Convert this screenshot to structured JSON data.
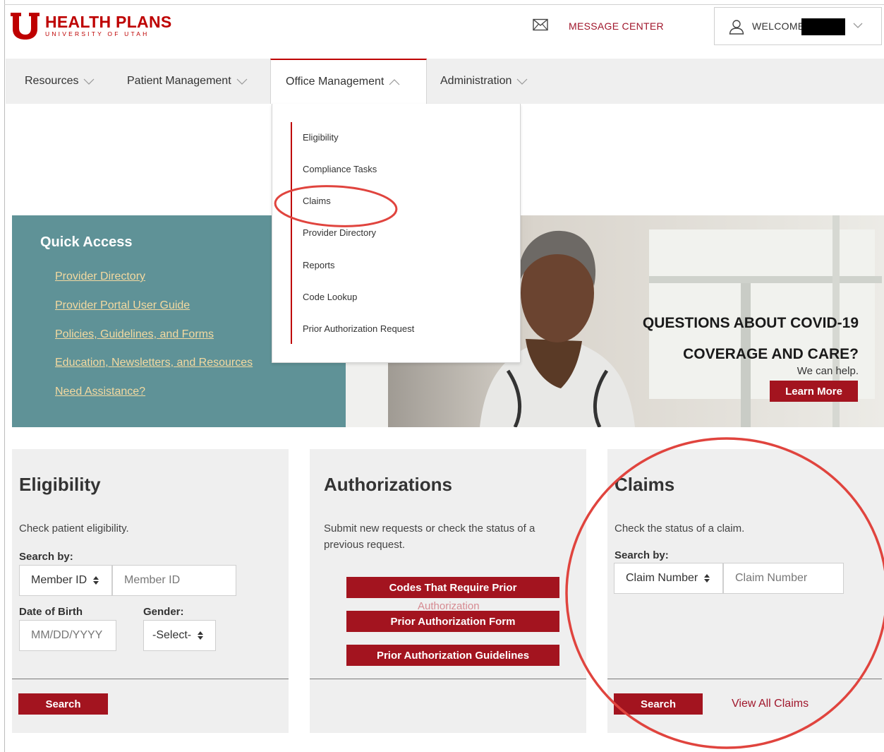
{
  "header": {
    "logo": {
      "title": "HEALTH PLANS",
      "subtitle": "UNIVERSITY OF UTAH"
    },
    "message_center": "MESSAGE CENTER",
    "welcome": "WELCOME"
  },
  "nav": {
    "items": [
      {
        "label": "Resources"
      },
      {
        "label": "Patient Management"
      },
      {
        "label": "Office Management"
      },
      {
        "label": "Administration"
      }
    ]
  },
  "dropdown": {
    "items": [
      {
        "label": "Eligibility"
      },
      {
        "label": "Compliance Tasks"
      },
      {
        "label": "Claims"
      },
      {
        "label": "Provider Directory"
      },
      {
        "label": "Reports"
      },
      {
        "label": "Code Lookup"
      },
      {
        "label": "Prior Authorization Request"
      }
    ]
  },
  "quick_access": {
    "title": "Quick Access",
    "links": [
      {
        "label": "Provider Directory"
      },
      {
        "label": "Provider Portal User Guide"
      },
      {
        "label": "Policies, Guidelines, and Forms"
      },
      {
        "label": "Education, Newsletters, and Resources"
      },
      {
        "label": "Need Assistance?"
      }
    ]
  },
  "banner": {
    "line1": "QUESTIONS ABOUT COVID-19",
    "line2": "COVERAGE AND CARE?",
    "subtext": "We can help.",
    "button": "Learn More"
  },
  "eligibility": {
    "title": "Eligibility",
    "description": "Check patient eligibility.",
    "search_by_label": "Search by:",
    "search_by_value": "Member ID",
    "member_id_placeholder": "Member ID",
    "dob_label": "Date of Birth",
    "dob_placeholder": "MM/DD/YYYY",
    "gender_label": "Gender:",
    "gender_value": "-Select-",
    "search_button": "Search"
  },
  "authorizations": {
    "title": "Authorizations",
    "description": "Submit new requests or check the status of a previous request.",
    "buttons": [
      {
        "label": "Codes That Require Prior"
      },
      {
        "label": "Prior Authorization Form"
      },
      {
        "label": "Prior Authorization Guidelines"
      }
    ],
    "overflow_text": "Authorization"
  },
  "claims": {
    "title": "Claims",
    "description": "Check the status of a claim.",
    "search_by_label": "Search by:",
    "search_by_value": "Claim Number",
    "claim_number_placeholder": "Claim Number",
    "search_button": "Search",
    "view_all": "View All Claims"
  },
  "colors": {
    "brand_red": "#be0000",
    "button_red": "#a3141f",
    "teal": "#5f9297",
    "link_gold": "#f3d9a0",
    "annotation_red": "#e0443e"
  }
}
